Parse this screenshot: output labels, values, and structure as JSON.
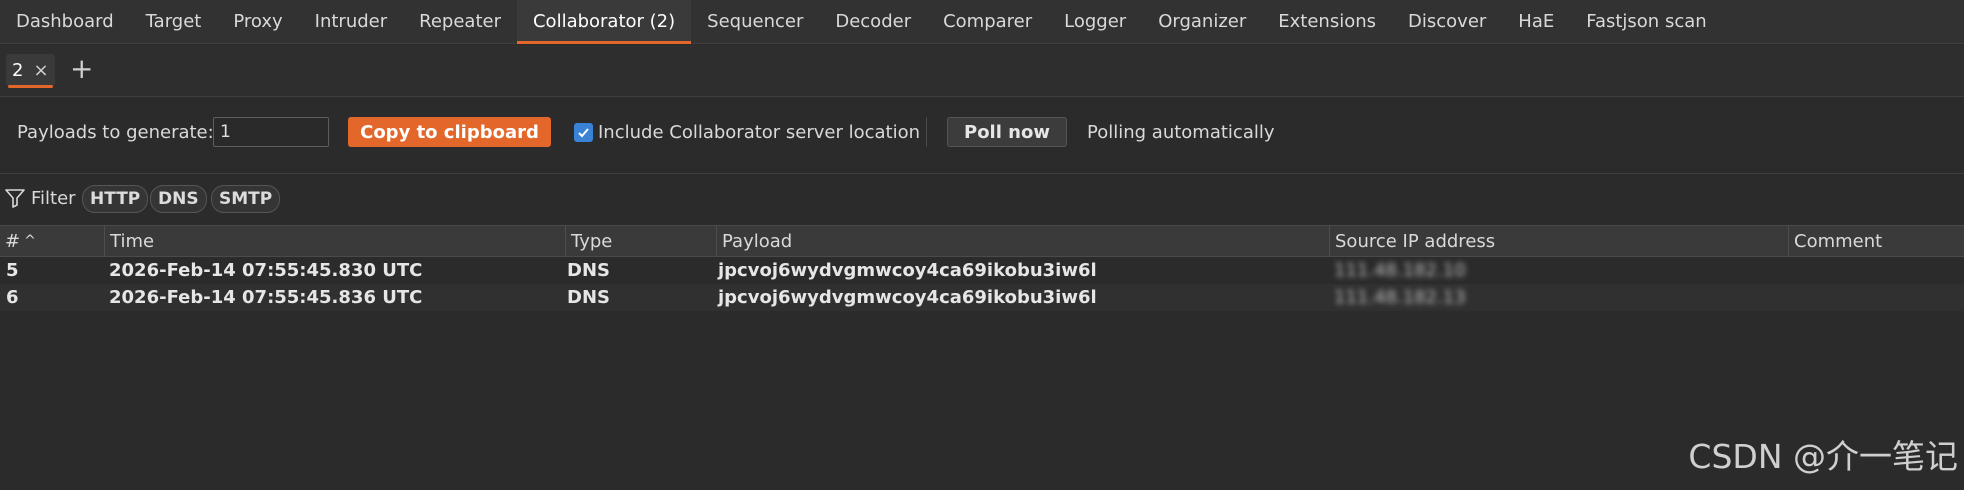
{
  "top_tabs": [
    {
      "label": "Dashboard"
    },
    {
      "label": "Target"
    },
    {
      "label": "Proxy"
    },
    {
      "label": "Intruder"
    },
    {
      "label": "Repeater"
    },
    {
      "label": "Collaborator (2)",
      "active": true
    },
    {
      "label": "Sequencer"
    },
    {
      "label": "Decoder"
    },
    {
      "label": "Comparer"
    },
    {
      "label": "Logger"
    },
    {
      "label": "Organizer"
    },
    {
      "label": "Extensions"
    },
    {
      "label": "Discover"
    },
    {
      "label": "HaE"
    },
    {
      "label": "Fastjson scan"
    }
  ],
  "sub_tabs": {
    "tab_label": "2",
    "close_glyph": "×",
    "add_glyph": "+"
  },
  "controls": {
    "payloads_label": "Payloads to generate:",
    "payloads_value": "1",
    "copy_button": "Copy to clipboard",
    "include_location_checked": true,
    "include_location_label": "Include Collaborator server location",
    "poll_button": "Poll now",
    "poll_status": "Polling automatically"
  },
  "filter": {
    "label": "Filter",
    "chips": [
      "HTTP",
      "DNS",
      "SMTP"
    ]
  },
  "table": {
    "columns": [
      "#",
      "Time",
      "Type",
      "Payload",
      "Source IP address",
      "Comment"
    ],
    "sort_indicator": "^",
    "rows": [
      {
        "num": "5",
        "time": "2026-Feb-14 07:55:45.830 UTC",
        "type": "DNS",
        "payload": "jpcvoj6wydvgmwcoy4ca69ikobu3iw6l",
        "source_ip": "111.48.182.10",
        "comment": ""
      },
      {
        "num": "6",
        "time": "2026-Feb-14 07:55:45.836 UTC",
        "type": "DNS",
        "payload": "jpcvoj6wydvgmwcoy4ca69ikobu3iw6l",
        "source_ip": "111.48.182.13",
        "comment": ""
      }
    ]
  },
  "watermark": "CSDN @介一笔记",
  "colors": {
    "accent": "#e3672b",
    "background": "#2b2b2b",
    "checkbox": "#3a82d6"
  }
}
